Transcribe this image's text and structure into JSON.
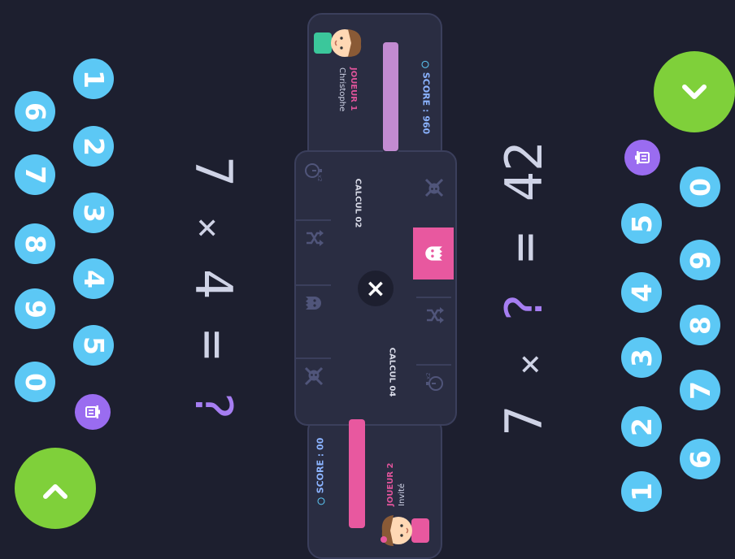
{
  "player1": {
    "label": "JOUEUR 1",
    "name": "Christophe",
    "score": "SCORE : 960",
    "score_progress": 0.85,
    "bar_color": "#c28bd1",
    "equation": {
      "a": "7",
      "op": "×",
      "b": "?",
      "eq": "=",
      "result": "42"
    },
    "calc_label": "CALCUL 02",
    "keypad": [
      "1",
      "2",
      "3",
      "4",
      "5",
      "6",
      "7",
      "8",
      "9",
      "0"
    ],
    "powers": [
      "skull-crossbones-icon",
      "ghost-icon",
      "shuffle-icon",
      "timer-x2-icon"
    ],
    "active_power": null
  },
  "player2": {
    "label": "JOUEUR 2",
    "name": "Invité",
    "score": "SCORE : 00",
    "score_progress": 0.85,
    "bar_color": "#e8589f",
    "equation": {
      "a": "7",
      "op": "×",
      "b": "4",
      "eq": "=",
      "result": "?"
    },
    "calc_label": "CALCUL 04",
    "keypad": [
      "1",
      "2",
      "3",
      "4",
      "5",
      "6",
      "7",
      "8",
      "9",
      "0"
    ],
    "powers": [
      "skull-crossbones-icon",
      "ghost-icon",
      "shuffle-icon",
      "timer-x2-icon"
    ],
    "active_power": "ghost-icon"
  },
  "center_close": "×",
  "timer_badge": "x2",
  "colors": {
    "background": "#1d1f2f",
    "key": "#5cc8f5",
    "delete": "#9a6cf0",
    "validate": "#7fd03a",
    "question": "#a67ef2",
    "active_power": "#e8589f"
  }
}
